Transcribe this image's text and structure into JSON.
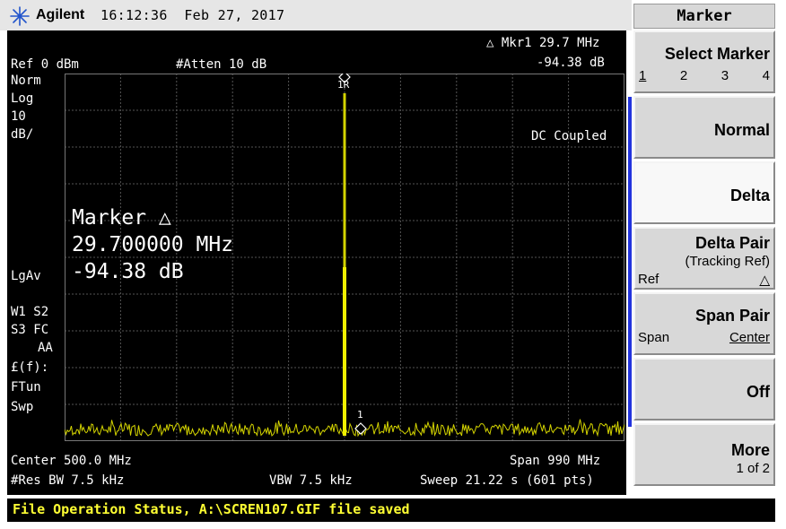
{
  "header": {
    "brand": "Agilent",
    "time": "16:12:36",
    "date": "Feb 27, 2017"
  },
  "screen": {
    "ref_level": "Ref 0 dBm",
    "atten": "#Atten 10 dB",
    "marker_readout_top": "△ Mkr1  29.7 MHz",
    "marker_readout_amp": "-94.38 dB",
    "left_annotations": [
      "Norm",
      "Log",
      "10",
      "dB/"
    ],
    "coupling": "DC Coupled",
    "avg_mode": "LgAv",
    "trace_flags": [
      "W1  S2",
      "S3  FC",
      "AA"
    ],
    "f_label": "£(f):",
    "ftun": "FTun",
    "swp": "Swp",
    "marker_big": {
      "title": "Marker △",
      "freq": "29.700000 MHz",
      "amp": "-94.38 dB"
    },
    "marker_ref_label": "1R",
    "marker_delta_label": "1",
    "center": "Center 500.0 MHz",
    "span": "Span 990 MHz",
    "rbw": "#Res BW 7.5 kHz",
    "vbw": "VBW 7.5 kHz",
    "sweep": "Sweep 21.22 s (601 pts)",
    "trace_color": "#d4d400"
  },
  "softkeys": {
    "menu_title": "Marker",
    "select_marker": {
      "label": "Select Marker",
      "options": [
        "1",
        "2",
        "3",
        "4"
      ],
      "active": "1"
    },
    "normal": "Normal",
    "delta": "Delta",
    "delta_pair": {
      "label": "Delta Pair",
      "sub": "(Tracking Ref)",
      "left": "Ref",
      "right": "△"
    },
    "span_pair": {
      "label": "Span Pair",
      "left": "Span",
      "right": "Center"
    },
    "off": "Off",
    "more": {
      "label": "More",
      "sub": "1 of 2"
    }
  },
  "status_bar": {
    "text": "File Operation Status, A:\\SCREN107.GIF file saved"
  }
}
